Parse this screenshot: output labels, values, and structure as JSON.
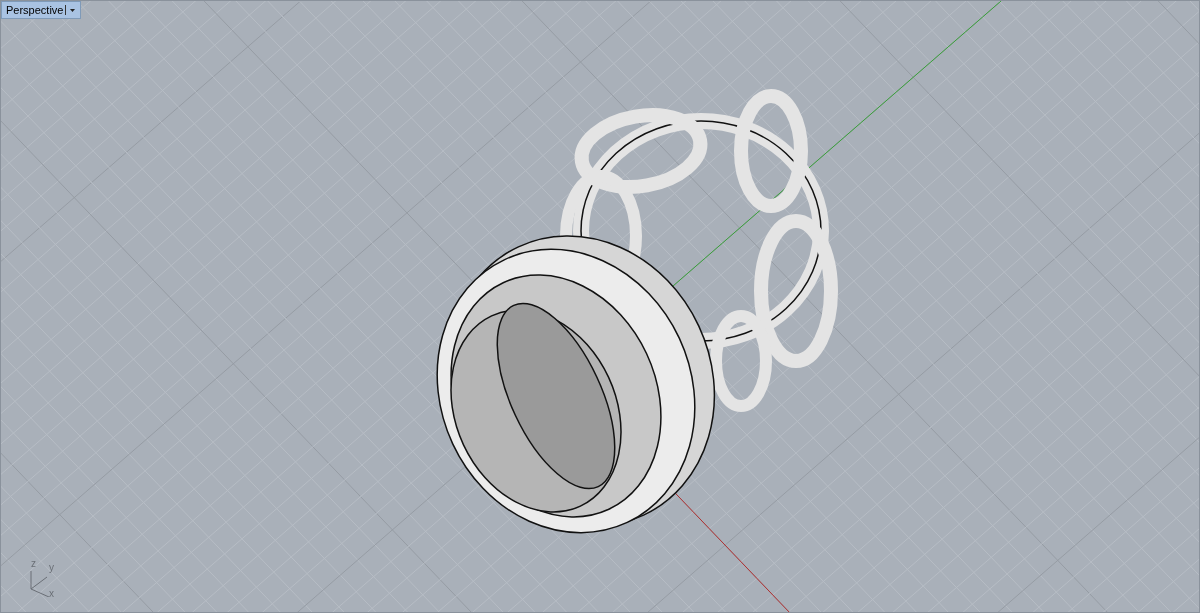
{
  "viewport": {
    "title": "Perspective"
  },
  "axis_gizmo": {
    "labels": [
      "z",
      "y",
      "x"
    ]
  }
}
